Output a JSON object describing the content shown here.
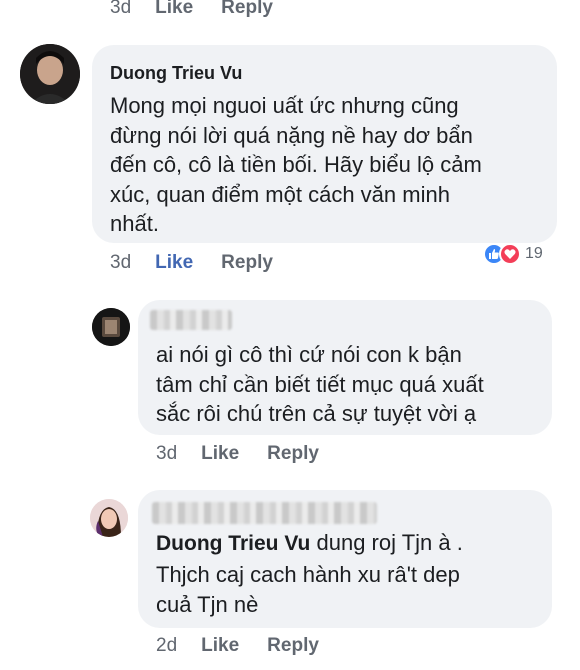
{
  "top_actions": {
    "time": "3d",
    "like": "Like",
    "reply": "Reply"
  },
  "comments": [
    {
      "author": "Duong Trieu Vu",
      "text_lines": [
        "Mong mọi nguoi uất ức nhưng cũng",
        "đừng nói lời quá nặng nề hay dơ bẩn",
        "đến cô, cô là tiền bối.  Hãy biểu lộ cảm",
        "xúc, quan điểm một cách văn minh",
        "nhất."
      ],
      "reactions": {
        "count": "19",
        "icons": [
          "like-icon",
          "love-icon"
        ]
      },
      "actions": {
        "time": "3d",
        "like": "Like",
        "reply": "Reply"
      }
    },
    {
      "author": "",
      "author_blurred": true,
      "text_lines": [
        "ai nói gì cô thì cứ nói con k bận",
        "tâm chỉ cần biết tiết mục quá xuất",
        "sắc rôi chú trên cả sự tuyệt vời ạ"
      ],
      "actions": {
        "time": "3d",
        "like": "Like",
        "reply": "Reply"
      }
    },
    {
      "author": "",
      "author_blurred": true,
      "mention": "Duong Trieu Vu",
      "text_lines": [
        " dung roj Tjn à .",
        "Thjch caj cach hành xu râ't dep",
        "cuả Tjn nè"
      ],
      "actions": {
        "time": "2d",
        "like": "Like",
        "reply": "Reply"
      }
    }
  ],
  "colors": {
    "bubble": "#f0f2f5",
    "link_blue": "#4267b2",
    "meta_gray": "#616770"
  }
}
